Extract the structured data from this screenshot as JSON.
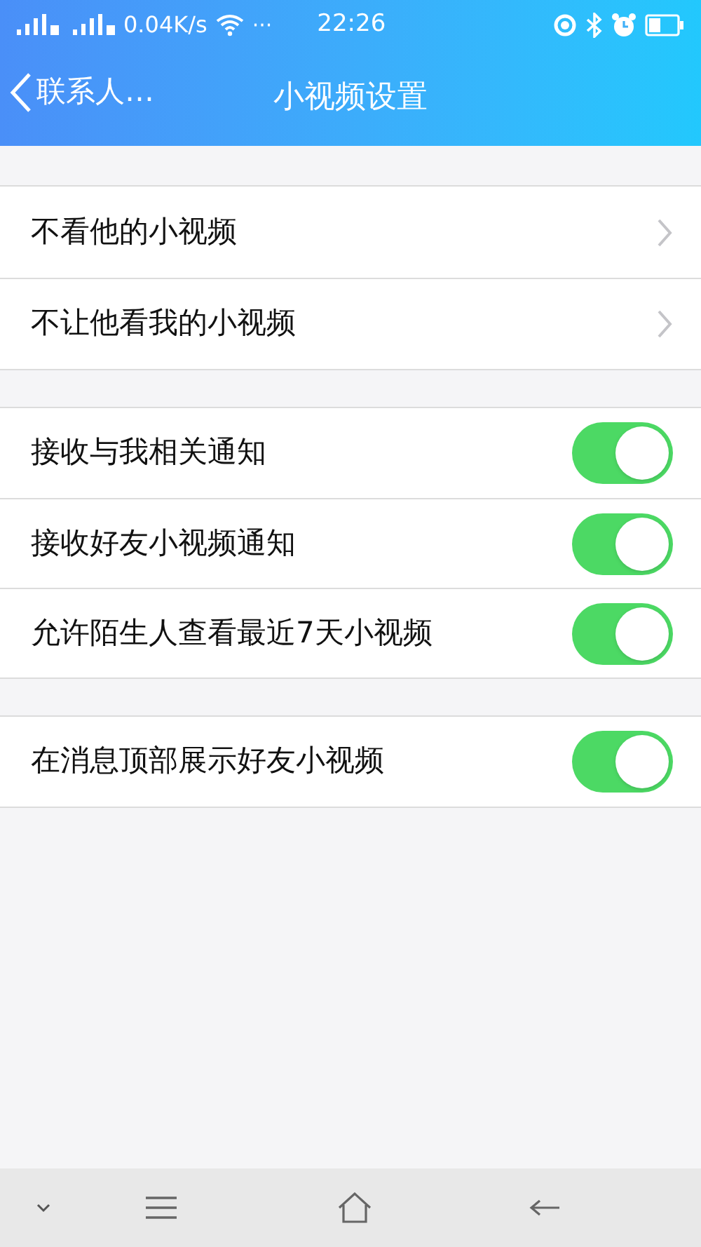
{
  "status_bar": {
    "network_speed": "0.04K/s",
    "more": "···",
    "time": "22:26"
  },
  "nav": {
    "back_label": "联系人…",
    "title": "小视频设置"
  },
  "groups": [
    {
      "items": [
        {
          "kind": "link",
          "label": "不看他的小视频"
        },
        {
          "kind": "link",
          "label": "不让他看我的小视频"
        }
      ]
    },
    {
      "items": [
        {
          "kind": "toggle",
          "label": "接收与我相关通知",
          "on": true
        },
        {
          "kind": "toggle",
          "label": "接收好友小视频通知",
          "on": true
        },
        {
          "kind": "toggle",
          "label": "允许陌生人查看最近7天小视频",
          "on": true
        }
      ]
    },
    {
      "items": [
        {
          "kind": "toggle",
          "label": "在消息顶部展示好友小视频",
          "on": true
        }
      ]
    }
  ]
}
